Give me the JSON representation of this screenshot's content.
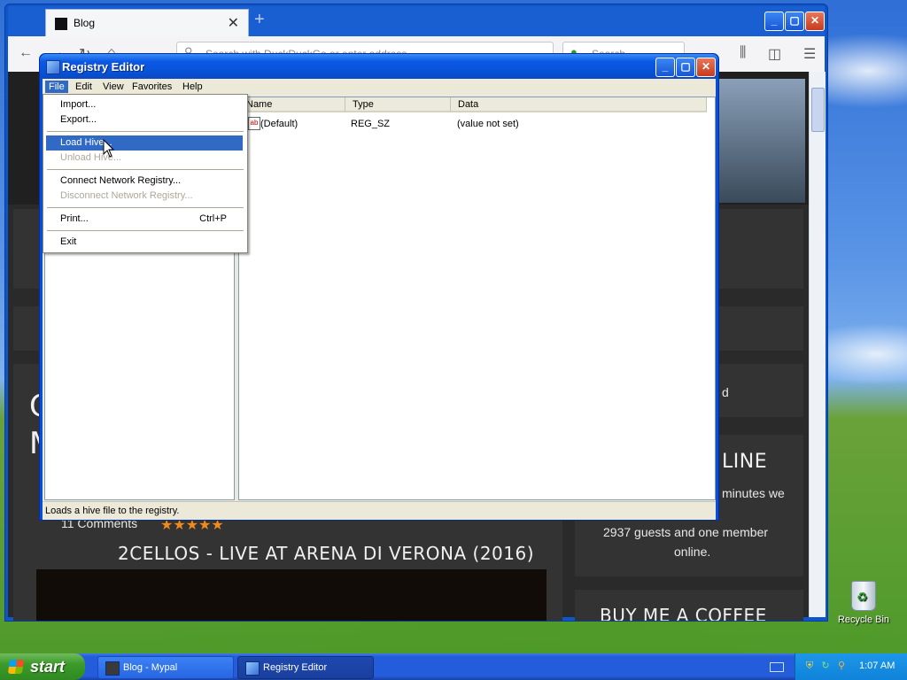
{
  "desktop": {
    "recycle_bin_label": "Recycle Bin"
  },
  "browser": {
    "tab_title": "Blog",
    "url_placeholder": "Search with DuckDuckGo or enter address",
    "search_placeholder": "Search",
    "page": {
      "heading_partial_left_1": "C",
      "heading_partial_left_2": "M",
      "comments": "11 Comments",
      "rating": "★★★★★",
      "post_title": "2CELLOS - LIVE AT ARENA DI VERONA (2016)",
      "sidebar_text_d": "d",
      "online_heading": "LINE",
      "minutes_we": "minutes we",
      "guests_line1": "2937 guests and one member",
      "guests_line2": "online.",
      "coffee_heading": "BUY ME A COFFEE"
    }
  },
  "regedit": {
    "title": "Registry Editor",
    "menus": [
      "File",
      "Edit",
      "View",
      "Favorites",
      "Help"
    ],
    "columns": [
      "Name",
      "Type",
      "Data"
    ],
    "rows": [
      {
        "name": "(Default)",
        "type": "REG_SZ",
        "data": "(value not set)"
      }
    ],
    "status": "Loads a hive file to the registry."
  },
  "file_menu": {
    "import": "Import...",
    "export": "Export...",
    "load_hive": "Load Hive...",
    "unload_hive": "Unload Hive...",
    "connect": "Connect Network Registry...",
    "disconnect": "Disconnect Network Registry...",
    "print": "Print...",
    "print_shortcut": "Ctrl+P",
    "exit": "Exit"
  },
  "taskbar": {
    "start_label": "start",
    "tasks": [
      {
        "label": "Blog - Mypal",
        "active": false
      },
      {
        "label": "Registry Editor",
        "active": true
      }
    ],
    "clock": "1:07 AM"
  },
  "colors": {
    "xp_blue": "#0b4ed6",
    "menu_highlight": "#316ac5",
    "start_green": "#3c9a2a"
  }
}
